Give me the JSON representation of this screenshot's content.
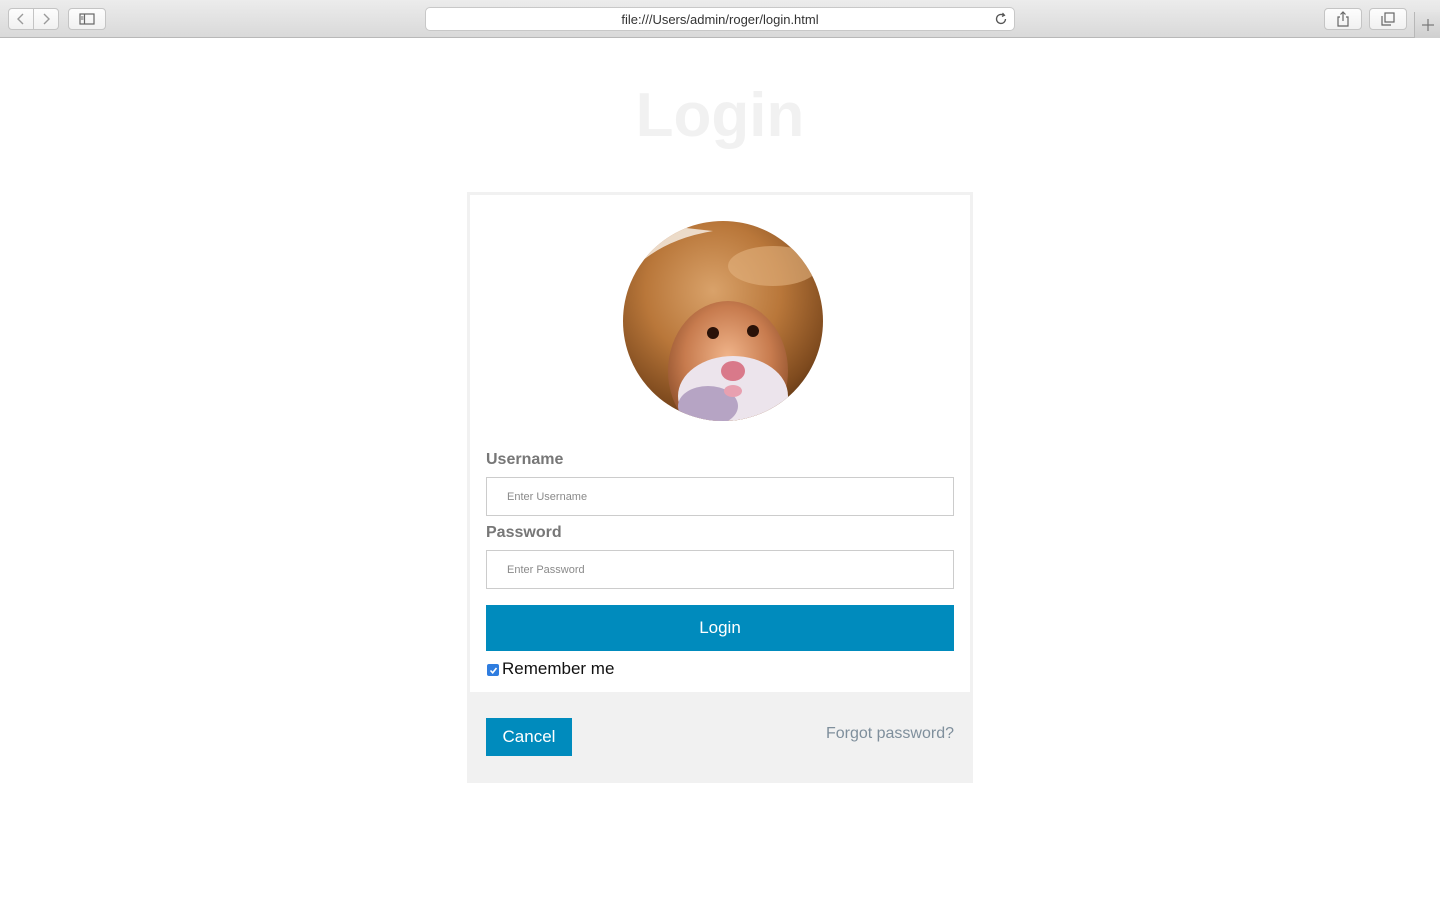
{
  "browser": {
    "url": "file:///Users/admin/roger/login.html"
  },
  "page": {
    "title": "Login"
  },
  "form": {
    "username_label": "Username",
    "username_placeholder": "Enter Username",
    "username_value": "",
    "password_label": "Password",
    "password_placeholder": "Enter Password",
    "password_value": "",
    "login_button": "Login",
    "remember_label": "Remember me",
    "remember_checked": true
  },
  "footer": {
    "cancel_button": "Cancel",
    "forgot_link": "Forgot password?"
  },
  "colors": {
    "accent": "#008bbd",
    "title": "#f1f1f1",
    "label": "#777777",
    "link": "#7f8f9c",
    "footer_bg": "#f1f1f1"
  },
  "icons": {
    "back": "chevron-left-icon",
    "forward": "chevron-right-icon",
    "sidebar": "sidebar-icon",
    "reload": "reload-icon",
    "share": "share-icon",
    "tabs": "tabs-icon",
    "new_tab": "plus-icon"
  }
}
